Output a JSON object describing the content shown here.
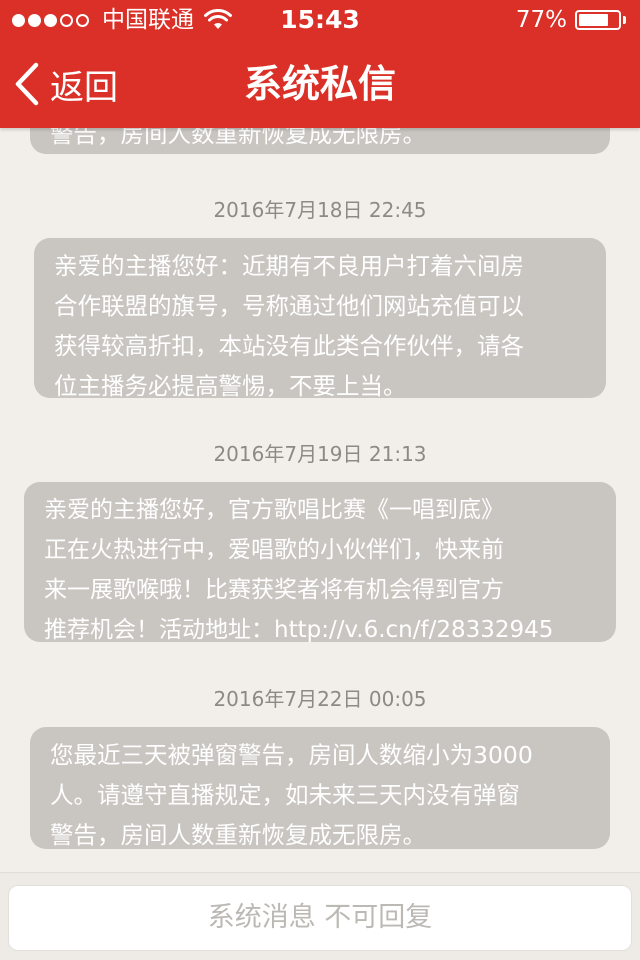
{
  "status_bar": {
    "carrier": "中国联通",
    "time": "15:43",
    "battery": "77%",
    "battery_level": 0.77,
    "signal_bars_filled": 3,
    "signal_bars_total": 5
  },
  "nav": {
    "back_label": "返回",
    "title": "系统私信"
  },
  "messages": [
    {
      "timestamp": "",
      "text": "警告，房间人数重新恢复成无限房。"
    },
    {
      "timestamp": "2016年7月18日 22:45",
      "text": "亲爱的主播您好：近期有不良用户打着六间房\n合作联盟的旗号，号称通过他们网站充值可以\n获得较高折扣，本站没有此类合作伙伴，请各\n位主播务必提高警惕，不要上当。"
    },
    {
      "timestamp": "2016年7月19日 21:13",
      "text": "亲爱的主播您好，官方歌唱比赛《一唱到底》\n正在火热进行中，爱唱歌的小伙伴们，快来前\n来一展歌喉哦！比赛获奖者将有机会得到官方\n推荐机会！活动地址：http://v.6.cn/f/28332945"
    },
    {
      "timestamp": "2016年7月22日 00:05",
      "text": "您最近三天被弹窗警告，房间人数缩小为3000\n人。请遵守直播规定，如未来三天内没有弹窗\n警告，房间人数重新恢复成无限房。"
    }
  ],
  "footer": {
    "placeholder": "系统消息 不可回复"
  },
  "colors": {
    "header": "#da3027",
    "bubble": "#c9c6c1",
    "background": "#f2efea"
  }
}
